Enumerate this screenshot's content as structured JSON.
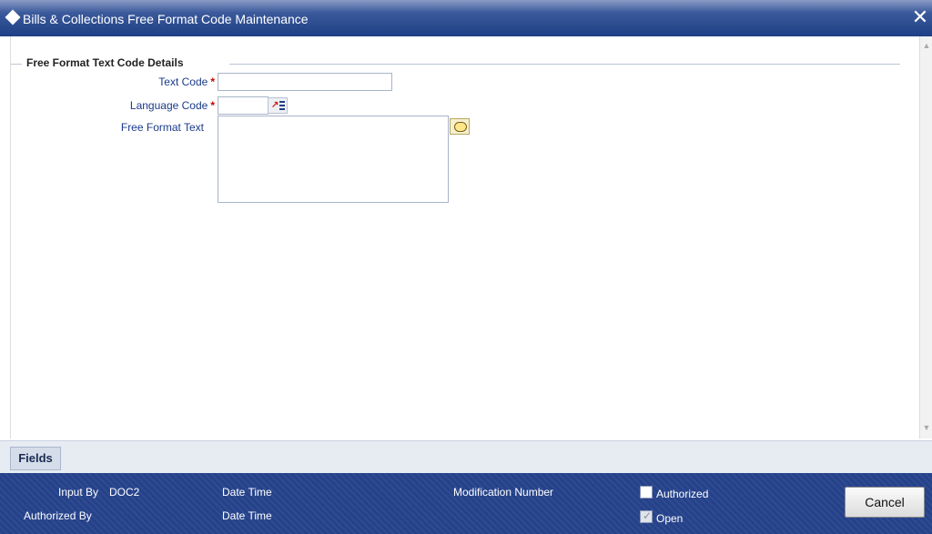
{
  "window": {
    "title": "Bills & Collections Free Format Code Maintenance",
    "close_glyph": "✕"
  },
  "section": {
    "title": "Free Format Text Code Details"
  },
  "form": {
    "text_code_label": "Text Code",
    "language_code_label": "Language Code",
    "free_format_text_label": "Free Format Text",
    "required_marker": "*",
    "text_code_value": "",
    "language_code_value": "",
    "free_format_text_value": ""
  },
  "icons": {
    "lov": "list-of-values-icon",
    "note": "speech-bubble-icon"
  },
  "tabs": {
    "fields": "Fields"
  },
  "footer": {
    "input_by_label": "Input By",
    "input_by_value": "DOC2",
    "authorized_by_label": "Authorized By",
    "date_time_label_1": "Date Time",
    "date_time_label_2": "Date Time",
    "modification_number_label": "Modification Number",
    "authorized_label": "Authorized",
    "authorized_checked": false,
    "open_label": "Open",
    "open_checked": true,
    "cancel_label": "Cancel"
  },
  "colors": {
    "title_bar": "#1f3f86",
    "footer": "#24418a",
    "label": "#1a3a8a",
    "required": "#cc0000"
  }
}
